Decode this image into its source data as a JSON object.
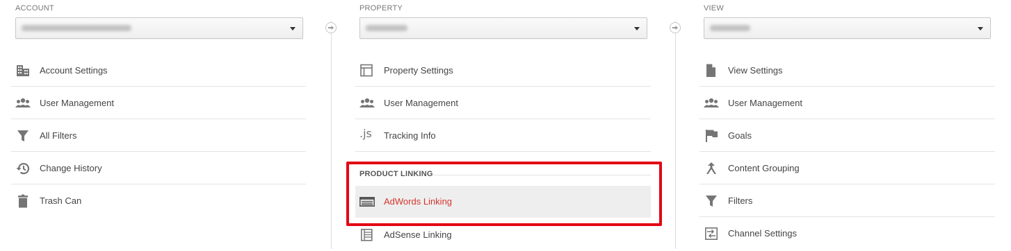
{
  "account": {
    "label": "ACCOUNT",
    "items": [
      {
        "label": "Account Settings",
        "icon": "building-icon"
      },
      {
        "label": "User Management",
        "icon": "users-icon"
      },
      {
        "label": "All Filters",
        "icon": "filter-icon"
      },
      {
        "label": "Change History",
        "icon": "history-icon"
      },
      {
        "label": "Trash Can",
        "icon": "trash-icon"
      }
    ]
  },
  "property": {
    "label": "PROPERTY",
    "items": [
      {
        "label": "Property Settings",
        "icon": "layout-icon"
      },
      {
        "label": "User Management",
        "icon": "users-icon"
      },
      {
        "label": "Tracking Info",
        "icon": "js-icon"
      }
    ],
    "js_glyph": ".js",
    "product_linking": {
      "heading": "PRODUCT LINKING",
      "items": [
        {
          "label": "AdWords Linking",
          "icon": "adwords-icon",
          "active": true
        },
        {
          "label": "AdSense Linking",
          "icon": "adsense-icon"
        }
      ]
    }
  },
  "view": {
    "label": "VIEW",
    "items": [
      {
        "label": "View Settings",
        "icon": "document-icon"
      },
      {
        "label": "User Management",
        "icon": "users-icon"
      },
      {
        "label": "Goals",
        "icon": "flag-icon"
      },
      {
        "label": "Content Grouping",
        "icon": "grouping-icon"
      },
      {
        "label": "Filters",
        "icon": "filter-icon"
      },
      {
        "label": "Channel Settings",
        "icon": "channel-icon"
      }
    ]
  },
  "colors": {
    "active_text": "#d2362d",
    "highlight": "#e30613",
    "icon": "#757575"
  }
}
